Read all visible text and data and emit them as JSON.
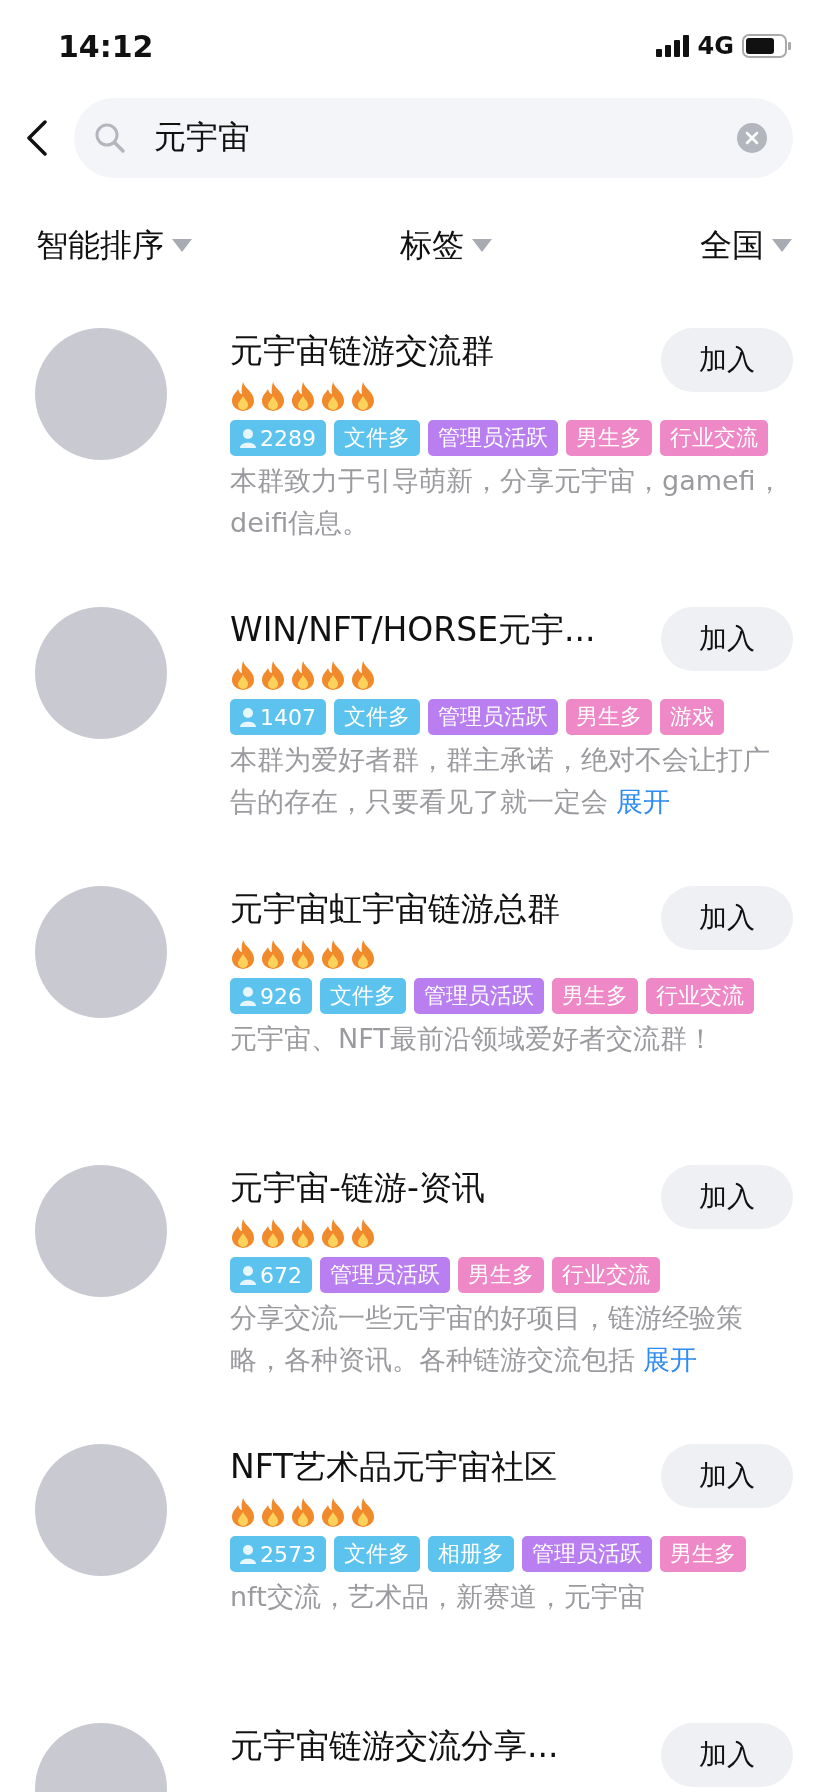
{
  "status_bar": {
    "time": "14:12",
    "network": "4G"
  },
  "search": {
    "value": "元宇宙"
  },
  "filters": [
    {
      "label": "智能排序"
    },
    {
      "label": "标签"
    },
    {
      "label": "全国"
    }
  ],
  "groups": [
    {
      "title": "元宇宙链游交流群",
      "stars": 5,
      "button": "加入",
      "tags": [
        {
          "kind": "members",
          "text": "2289",
          "color": "#5cc3ef"
        },
        {
          "kind": "tag",
          "text": "文件多",
          "color": "#5cc3ef"
        },
        {
          "kind": "tag",
          "text": "管理员活跃",
          "color": "#b97ff0"
        },
        {
          "kind": "tag",
          "text": "男生多",
          "color": "#ee88c6"
        },
        {
          "kind": "tag",
          "text": "行业交流",
          "color": "#ee88c6"
        }
      ],
      "description": "本群致力于引导萌新，分享元宇宙，gamefi，deifi信息。"
    },
    {
      "title": "WIN/NFT/HORSE元宇...",
      "stars": 5,
      "button": "加入",
      "tags": [
        {
          "kind": "members",
          "text": "1407",
          "color": "#5cc3ef"
        },
        {
          "kind": "tag",
          "text": "文件多",
          "color": "#5cc3ef"
        },
        {
          "kind": "tag",
          "text": "管理员活跃",
          "color": "#b97ff0"
        },
        {
          "kind": "tag",
          "text": "男生多",
          "color": "#ee88c6"
        },
        {
          "kind": "tag",
          "text": "游戏",
          "color": "#ee88c6"
        }
      ],
      "description": "本群为爱好者群，群主承诺，绝对不会让打广告的存在，只要看见了就一定会",
      "expand": "展开"
    },
    {
      "title": "元宇宙虹宇宙链游总群",
      "stars": 5,
      "button": "加入",
      "tags": [
        {
          "kind": "members",
          "text": "926",
          "color": "#5cc3ef"
        },
        {
          "kind": "tag",
          "text": "文件多",
          "color": "#5cc3ef"
        },
        {
          "kind": "tag",
          "text": "管理员活跃",
          "color": "#b97ff0"
        },
        {
          "kind": "tag",
          "text": "男生多",
          "color": "#ee88c6"
        },
        {
          "kind": "tag",
          "text": "行业交流",
          "color": "#ee88c6"
        }
      ],
      "description": "元宇宙、NFT最前沿领域爱好者交流群！"
    },
    {
      "title": "元宇宙-链游-资讯",
      "stars": 5,
      "button": "加入",
      "tags": [
        {
          "kind": "members",
          "text": "672",
          "color": "#5cc3ef"
        },
        {
          "kind": "tag",
          "text": "管理员活跃",
          "color": "#b97ff0"
        },
        {
          "kind": "tag",
          "text": "男生多",
          "color": "#ee88c6"
        },
        {
          "kind": "tag",
          "text": "行业交流",
          "color": "#ee88c6"
        }
      ],
      "description": "分享交流一些元宇宙的好项目，链游经验策略，各种资讯。各种链游交流包括",
      "expand": "展开"
    },
    {
      "title": "NFT艺术品元宇宙社区",
      "stars": 5,
      "button": "加入",
      "tags": [
        {
          "kind": "members",
          "text": "2573",
          "color": "#5cc3ef"
        },
        {
          "kind": "tag",
          "text": "文件多",
          "color": "#5cc3ef"
        },
        {
          "kind": "tag",
          "text": "相册多",
          "color": "#5cc3ef"
        },
        {
          "kind": "tag",
          "text": "管理员活跃",
          "color": "#b97ff0"
        },
        {
          "kind": "tag",
          "text": "男生多",
          "color": "#ee88c6"
        }
      ],
      "description": "nft交流，艺术品，新赛道，元宇宙"
    },
    {
      "title": "元宇宙链游交流分享...",
      "button": "加入"
    }
  ]
}
